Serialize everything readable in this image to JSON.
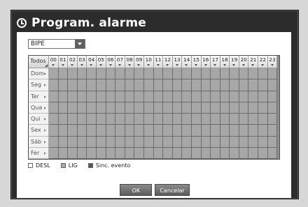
{
  "window": {
    "title": "Program. alarme"
  },
  "dropdown": {
    "selected": "BIPE"
  },
  "schedule": {
    "corner_label": "Todos",
    "hours": [
      "00",
      "01",
      "02",
      "03",
      "04",
      "05",
      "06",
      "07",
      "08",
      "09",
      "10",
      "11",
      "12",
      "13",
      "14",
      "15",
      "16",
      "17",
      "18",
      "19",
      "20",
      "21",
      "22",
      "23"
    ],
    "days": [
      "Dom",
      "Seg",
      "Ter",
      "Qua",
      "Qui",
      "Sex",
      "Sáb",
      "Fer"
    ]
  },
  "legend": {
    "off": "DESL",
    "on": "LIG",
    "sync": "Sinc. evento"
  },
  "buttons": {
    "ok": "OK",
    "cancel": "Cancelar"
  },
  "colors": {
    "dialog_bg": "#2c2c2c",
    "cell_fill": "#a7a7a7",
    "grid_lines": "#6c6c6c",
    "button_bg": "#707070"
  },
  "icons": {
    "title": "clock-icon",
    "dropdown": "chevron-down-icon"
  }
}
